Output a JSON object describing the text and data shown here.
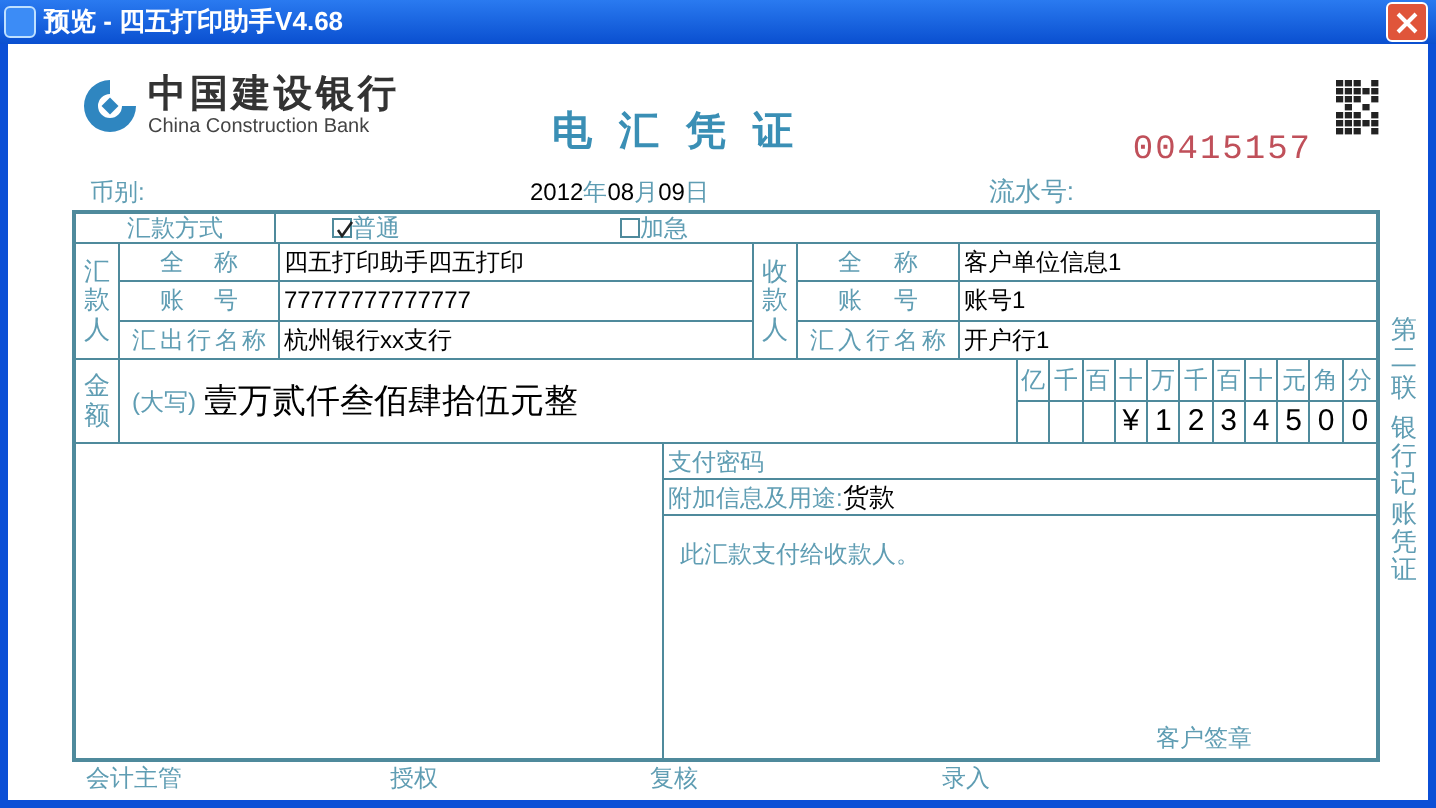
{
  "window": {
    "title": "预览 - 四五打印助手V4.68"
  },
  "form": {
    "bank_name": "中国建设银行",
    "bank_name_en": "China Construction Bank",
    "title": "电 汇 凭 证",
    "serial_number": "00415157",
    "currency_label": "币别:",
    "date": {
      "year": "2012",
      "year_unit": "年",
      "month": "08",
      "month_unit": "月",
      "day": "09",
      "day_unit": "日"
    },
    "serial_label": "流水号:",
    "remit_method": {
      "label": "汇款方式",
      "options": [
        {
          "label": "普通",
          "checked": true
        },
        {
          "label": "加急",
          "checked": false
        }
      ]
    },
    "remitter": {
      "side_label": "汇款人",
      "rows": [
        {
          "label": "全称",
          "value": "四五打印助手四五打印"
        },
        {
          "label": "账号",
          "value": "77777777777777"
        },
        {
          "label": "汇出行名称",
          "value": "杭州银行xx支行"
        }
      ]
    },
    "payee": {
      "side_label": "收款人",
      "rows": [
        {
          "label": "全称",
          "value": "客户单位信息1"
        },
        {
          "label": "账号",
          "value": "账号1"
        },
        {
          "label": "汇入行名称",
          "value": "开户行1"
        }
      ]
    },
    "amount": {
      "side_label": "金额",
      "caps_label": "(大写)",
      "words": "壹万贰仟叁佰肆拾伍元整",
      "digit_headers": [
        "亿",
        "千",
        "百",
        "十",
        "万",
        "千",
        "百",
        "十",
        "元",
        "角",
        "分"
      ],
      "digits": [
        "¥",
        "1",
        "2",
        "3",
        "4",
        "5",
        "0",
        "0"
      ]
    },
    "payment_password_label": "支付密码",
    "extra_info_label": "附加信息及用途:",
    "extra_info_value": "货款",
    "note": "此汇款支付给收款人。",
    "signature_label": "客户签章",
    "copy_label": "第二联",
    "copy_purpose": "银行记账凭证",
    "footer": [
      "会计主管",
      "授权",
      "复核",
      "录入"
    ]
  }
}
